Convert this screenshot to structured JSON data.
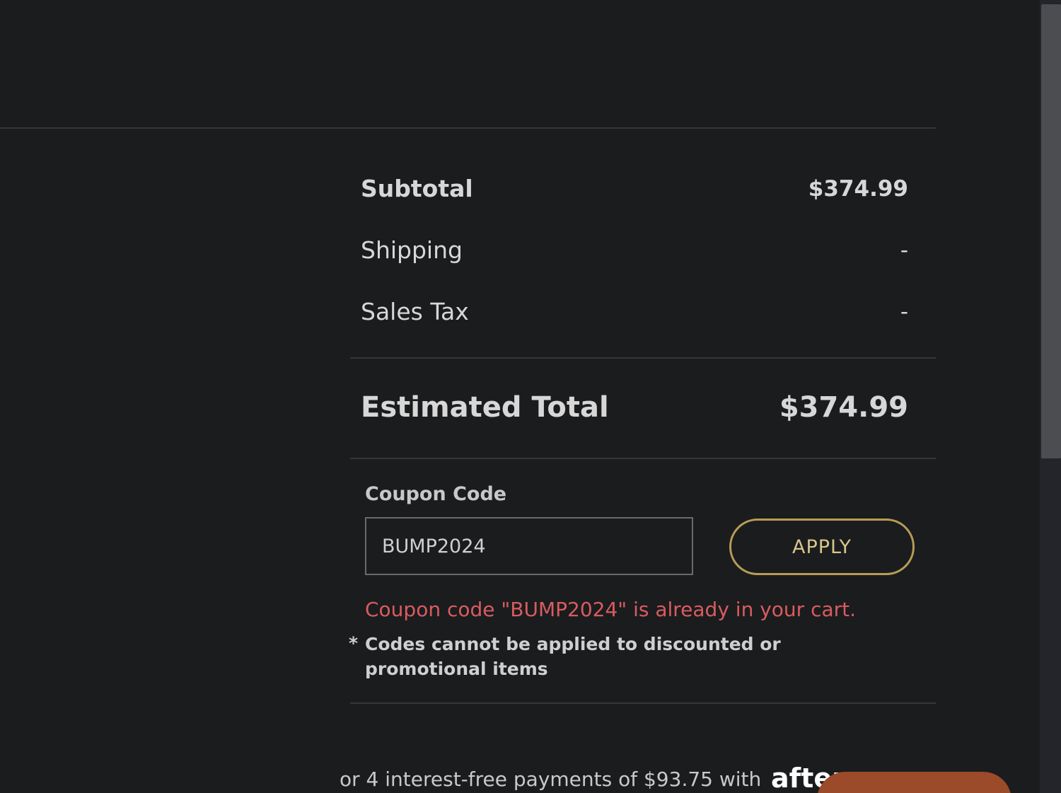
{
  "summary": {
    "subtotal_label": "Subtotal",
    "subtotal_value": "$374.99",
    "shipping_label": "Shipping",
    "shipping_value": "-",
    "tax_label": "Sales Tax",
    "tax_value": "-",
    "total_label": "Estimated Total",
    "total_value": "$374.99"
  },
  "coupon": {
    "title": "Coupon Code",
    "input_value": "BUMP2024",
    "apply_label": "APPLY",
    "error_message": "Coupon code \"BUMP2024\" is already in your cart.",
    "note_marker": "*",
    "note": "Codes cannot be applied to discounted or promotional items"
  },
  "afterpay": {
    "text": "or 4 interest-free payments of $93.75 with",
    "logo_text": "after"
  },
  "colors": {
    "background": "#1b1c1e",
    "error": "#d85c5f",
    "accent_gold": "#b69d55",
    "chat_bubble": "#9b4a2a"
  }
}
